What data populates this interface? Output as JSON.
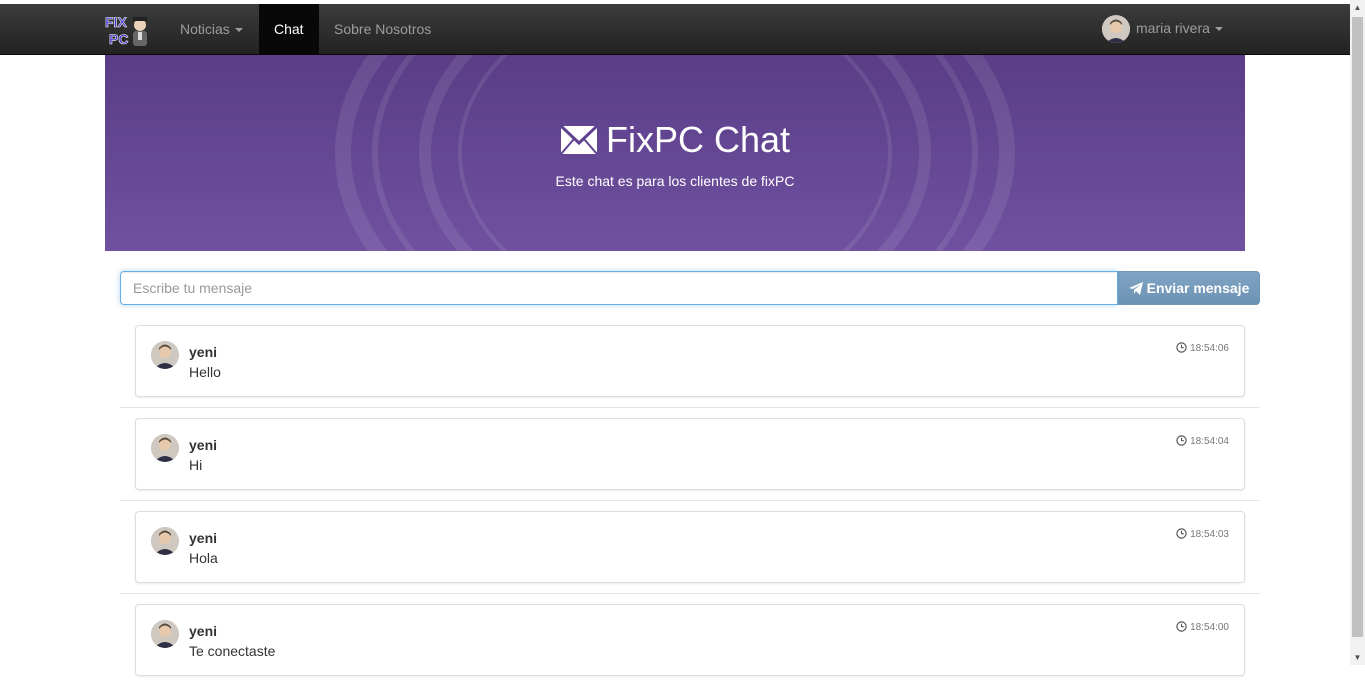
{
  "navbar": {
    "brand_text_top": "FIX",
    "brand_text_bottom": "PC",
    "items": [
      {
        "label": "Noticias",
        "dropdown": true,
        "active": false
      },
      {
        "label": "Chat",
        "dropdown": false,
        "active": true
      },
      {
        "label": "Sobre Nosotros",
        "dropdown": false,
        "active": false
      }
    ],
    "user": {
      "name": "maria rivera"
    }
  },
  "hero": {
    "title": "FixPC Chat",
    "subtitle": "Este chat es para los clientes de fixPC",
    "icon": "envelope-icon",
    "bg_color": "#5e4290"
  },
  "composer": {
    "placeholder": "Escribe tu mensaje",
    "value": "",
    "send_label": "Enviar mensaje",
    "send_icon": "paper-plane-icon"
  },
  "messages": [
    {
      "user": "yeni",
      "text": "Hello",
      "time": "18:54:06"
    },
    {
      "user": "yeni",
      "text": "Hi",
      "time": "18:54:04"
    },
    {
      "user": "yeni",
      "text": "Hola",
      "time": "18:54:03"
    },
    {
      "user": "yeni",
      "text": "Te conectaste",
      "time": "18:54:00"
    }
  ],
  "colors": {
    "navbar": "#222222",
    "hero": "#5e4290",
    "send_button": "#7296b6",
    "input_focus": "#66afe9"
  }
}
